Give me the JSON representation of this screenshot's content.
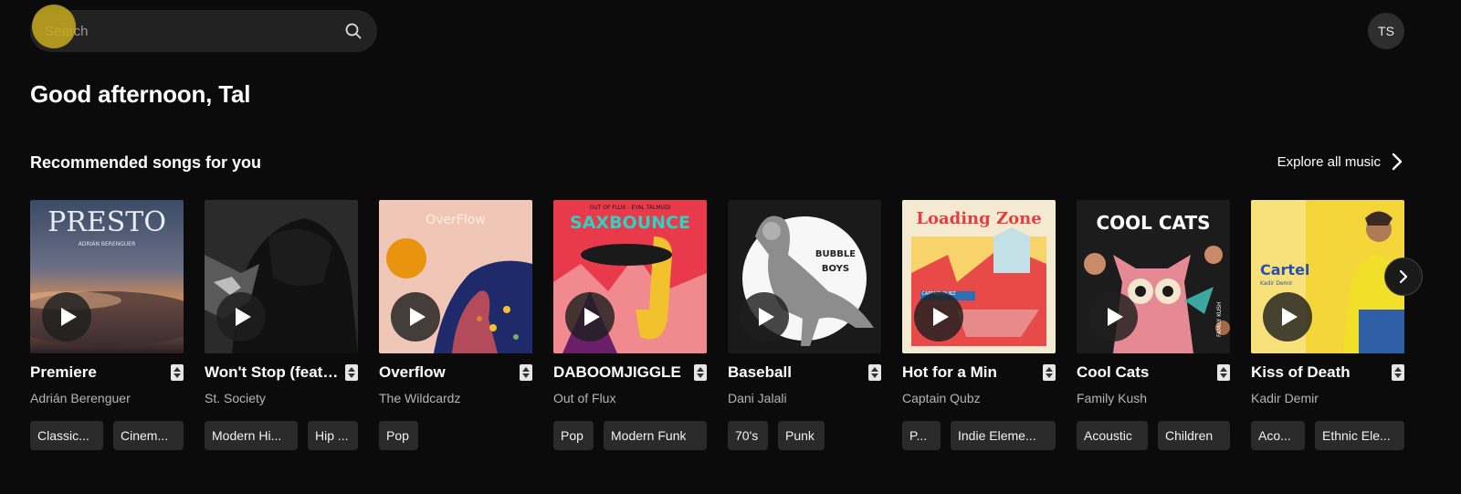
{
  "search": {
    "placeholder": "Search",
    "icon": "search-icon"
  },
  "user": {
    "initials": "TS"
  },
  "greeting": "Good afternoon, Tal",
  "section": {
    "title": "Recommended songs for you",
    "explore_label": "Explore all music"
  },
  "songs": [
    {
      "title": "Premiere",
      "artist": "Adrián Berenguer",
      "tags": [
        "Classic...",
        "Cinem..."
      ],
      "cover_text": "PRESTO",
      "cover_sub": "ADRIÁN BERENGUER"
    },
    {
      "title": "Won't Stop (feat. ...",
      "artist": "St. Society",
      "tags": [
        "Modern Hi...",
        "Hip ..."
      ]
    },
    {
      "title": "Overflow",
      "artist": "The Wildcardz",
      "tags": [
        "Pop"
      ],
      "cover_text": "OverFlow"
    },
    {
      "title": "DABOOMJIGGLE",
      "artist": "Out of Flux",
      "tags": [
        "Pop",
        "Modern Funk"
      ],
      "cover_text": "SAXBOUNCE",
      "cover_sub": "OUT OF FLUX - EYAL TALMUDI"
    },
    {
      "title": "Baseball",
      "artist": "Dani Jalali",
      "tags": [
        "70's",
        "Punk"
      ],
      "cover_text": "BUBBLE",
      "cover_sub": "BOYS"
    },
    {
      "title": "Hot for a Min",
      "artist": "Captain Qubz",
      "tags": [
        "P...",
        "Indie Eleme..."
      ],
      "cover_text": "Loading Zone",
      "cover_sub": "CAPTAIN QUBZ"
    },
    {
      "title": "Cool Cats",
      "artist": "Family Kush",
      "tags": [
        "Acoustic",
        "Children"
      ],
      "cover_text": "COOL CATS",
      "cover_sub": "FAMILY KUSH"
    },
    {
      "title": "Kiss of Death",
      "artist": "Kadir Demir",
      "tags": [
        "Aco...",
        "Ethnic Ele..."
      ],
      "cover_text": "Cartel",
      "cover_sub": "Kadir Demir"
    }
  ],
  "colors": {
    "background": "#0b0b0b",
    "tag_bg": "#2a2a2a",
    "muted_text": "#b5b5b5"
  }
}
